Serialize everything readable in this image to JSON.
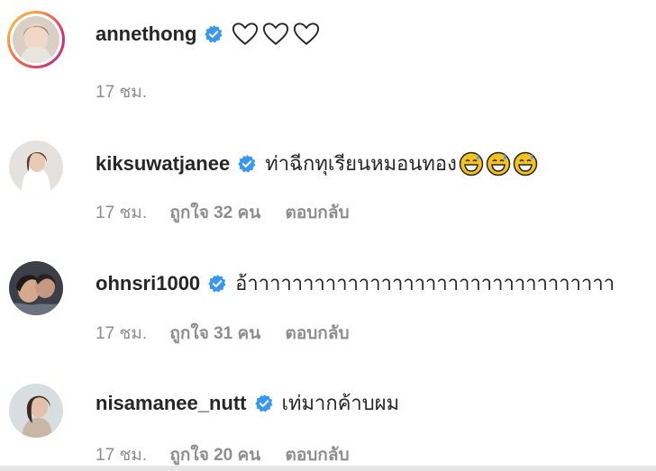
{
  "comments": [
    {
      "username": "annethong",
      "text": "",
      "hearts": 3,
      "time": "17 ชม.",
      "likes": "",
      "reply": ""
    },
    {
      "username": "kiksuwatjanee",
      "text": "ท่าฉีกทุเรียนหมอนทอง",
      "emoji_count": 3,
      "time": "17 ชม.",
      "likes": "ถูกใจ 32 คน",
      "reply": "ตอบกลับ"
    },
    {
      "username": "ohnsri1000",
      "text": "อ้าาาาาาาาาาาาาาาาาาาาาาาาาาาาาาาาา",
      "time": "17 ชม.",
      "likes": "ถูกใจ 31 คน",
      "reply": "ตอบกลับ"
    },
    {
      "username": "nisamanee_nutt",
      "text": "เท่มากค้าบผม",
      "time": "17 ชม.",
      "likes": "ถูกใจ 20 คน",
      "reply": "ตอบกลับ"
    }
  ],
  "colors": {
    "verified": "#3897f0",
    "meta_text": "#8e8e8e",
    "username": "#262626"
  },
  "icons": {
    "verified": "verified-badge-icon",
    "heart": "heart-outline-icon",
    "emoji": "grinning-sweat-emoji-icon"
  }
}
